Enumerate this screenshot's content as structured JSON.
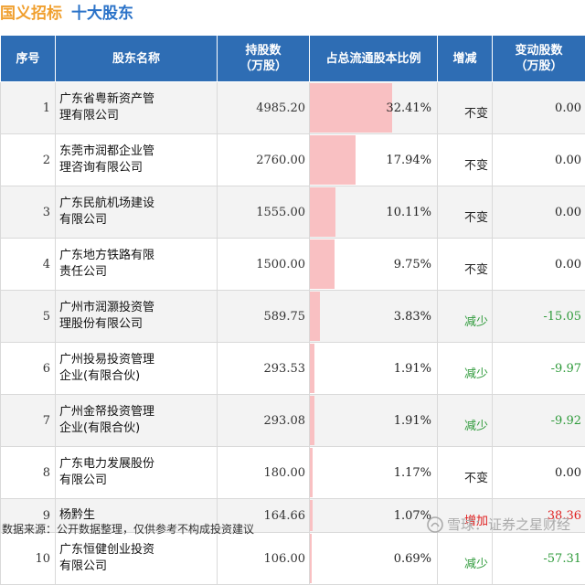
{
  "title": {
    "company": "国义招标",
    "subtitle": "十大股东"
  },
  "columns": {
    "index": "序号",
    "name": "股东名称",
    "shares": "持股数\n（万股）",
    "ratio": "占总流通股本比例",
    "change_type": "增减",
    "change_shares": "变动股数\n（万股）"
  },
  "colors": {
    "header": "#2e6db4",
    "ratio_bar": "#f9c0c2",
    "unchanged": "#222222",
    "decrease": "#2e9a3a",
    "increase": "#e02020",
    "title_company": "#f0a030",
    "title_sub": "#2a72c8"
  },
  "rows": [
    {
      "index": "1",
      "name_line1": "广东省粤新资产管",
      "name_line2": "理有限公司",
      "shares": "4985.20",
      "ratio": "32.41%",
      "ratio_value": 32.41,
      "change_type": "不变",
      "status": "unchanged",
      "change_shares": "0.00"
    },
    {
      "index": "2",
      "name_line1": "东莞市润都企业管",
      "name_line2": "理咨询有限公司",
      "shares": "2760.00",
      "ratio": "17.94%",
      "ratio_value": 17.94,
      "change_type": "不变",
      "status": "unchanged",
      "change_shares": "0.00"
    },
    {
      "index": "3",
      "name_line1": "广东民航机场建设",
      "name_line2": "有限公司",
      "shares": "1555.00",
      "ratio": "10.11%",
      "ratio_value": 10.11,
      "change_type": "不变",
      "status": "unchanged",
      "change_shares": "0.00"
    },
    {
      "index": "4",
      "name_line1": "广东地方铁路有限",
      "name_line2": "责任公司",
      "shares": "1500.00",
      "ratio": "9.75%",
      "ratio_value": 9.75,
      "change_type": "不变",
      "status": "unchanged",
      "change_shares": "0.00"
    },
    {
      "index": "5",
      "name_line1": "广州市润灏投资管",
      "name_line2": "理股份有限公司",
      "shares": "589.75",
      "ratio": "3.83%",
      "ratio_value": 3.83,
      "change_type": "减少",
      "status": "decrease",
      "change_shares": "-15.05"
    },
    {
      "index": "6",
      "name_line1": "广州投易投资管理",
      "name_line2": "企业(有限合伙)",
      "shares": "293.53",
      "ratio": "1.91%",
      "ratio_value": 1.91,
      "change_type": "减少",
      "status": "decrease",
      "change_shares": "-9.97"
    },
    {
      "index": "7",
      "name_line1": "广州金帑投资管理",
      "name_line2": "企业(有限合伙)",
      "shares": "293.08",
      "ratio": "1.91%",
      "ratio_value": 1.91,
      "change_type": "减少",
      "status": "decrease",
      "change_shares": "-9.92"
    },
    {
      "index": "8",
      "name_line1": "广东电力发展股份",
      "name_line2": "有限公司",
      "shares": "180.00",
      "ratio": "1.17%",
      "ratio_value": 1.17,
      "change_type": "不变",
      "status": "unchanged",
      "change_shares": "0.00"
    },
    {
      "index": "9",
      "name_line1": "杨黔生",
      "name_line2": "",
      "shares": "164.66",
      "ratio": "1.07%",
      "ratio_value": 1.07,
      "change_type": "增加",
      "status": "increase",
      "change_shares": "38.36"
    },
    {
      "index": "10",
      "name_line1": "广东恒健创业投资",
      "name_line2": "有限公司",
      "shares": "106.00",
      "ratio": "0.69%",
      "ratio_value": 0.69,
      "change_type": "减少",
      "status": "decrease",
      "change_shares": "-57.31"
    }
  ],
  "footer": {
    "source": "数据来源：公开数据整理，仅供参考不构成投资建议",
    "brand": "雪球：证券之星财经"
  }
}
